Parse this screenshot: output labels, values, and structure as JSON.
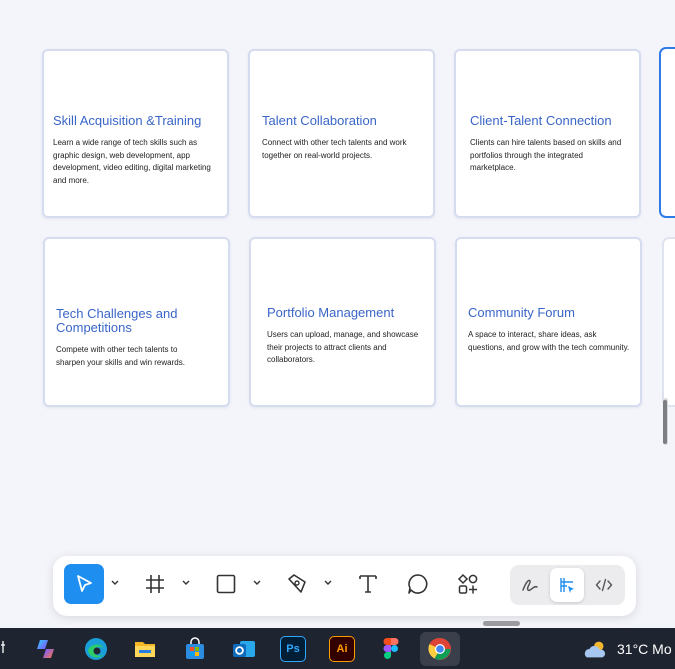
{
  "cards": [
    {
      "title": "Skill Acquisition &Training",
      "body": "Learn a wide range of tech skills such as graphic design, web development, app development, video editing, digital marketing and more."
    },
    {
      "title": "Talent Collaboration",
      "body": "Connect with other tech talents and work together on real-world projects."
    },
    {
      "title": "Client-Talent Connection",
      "body": "Clients can hire talents based on skills and portfolios through the integrated marketplace."
    },
    {
      "title": "Tech Challenges and Competitions",
      "body": "Compete with other tech talents to sharpen your skills and win rewards."
    },
    {
      "title": "Portfolio Management",
      "body": "Users can upload, manage, and showcase their projects to attract clients and collaborators."
    },
    {
      "title": "Community Forum",
      "body": "A space to interact, share ideas, ask questions, and grow with the tech community."
    }
  ],
  "toolbar": {
    "tools": [
      {
        "icon": "move-cursor-icon",
        "active": true,
        "has_menu": true
      },
      {
        "icon": "frame-hash-icon",
        "active": false,
        "has_menu": true
      },
      {
        "icon": "rectangle-icon",
        "active": false,
        "has_menu": true
      },
      {
        "icon": "pen-tool-icon",
        "active": false,
        "has_menu": true
      },
      {
        "icon": "text-tool-icon",
        "active": false,
        "has_menu": false
      },
      {
        "icon": "comment-bubble-icon",
        "active": false,
        "has_menu": false
      },
      {
        "icon": "components-icon",
        "active": false,
        "has_menu": false
      }
    ],
    "modes": [
      {
        "icon": "draw-mode-icon",
        "active": false
      },
      {
        "icon": "design-mode-icon",
        "active": true
      },
      {
        "icon": "dev-mode-icon",
        "active": false
      }
    ],
    "accent": "#1e8ef0"
  },
  "taskbar": {
    "apps": [
      {
        "icon": "copilot-icon"
      },
      {
        "icon": "edge-browser-icon"
      },
      {
        "icon": "file-explorer-icon"
      },
      {
        "icon": "microsoft-store-icon"
      },
      {
        "icon": "outlook-icon"
      },
      {
        "icon": "photoshop-icon",
        "label": "Ps"
      },
      {
        "icon": "illustrator-icon",
        "label": "Ai"
      },
      {
        "icon": "figma-icon"
      },
      {
        "icon": "chrome-icon",
        "active": true
      }
    ],
    "weather": {
      "icon": "cloudy-weather-icon",
      "text": "31°C  Mo"
    }
  }
}
